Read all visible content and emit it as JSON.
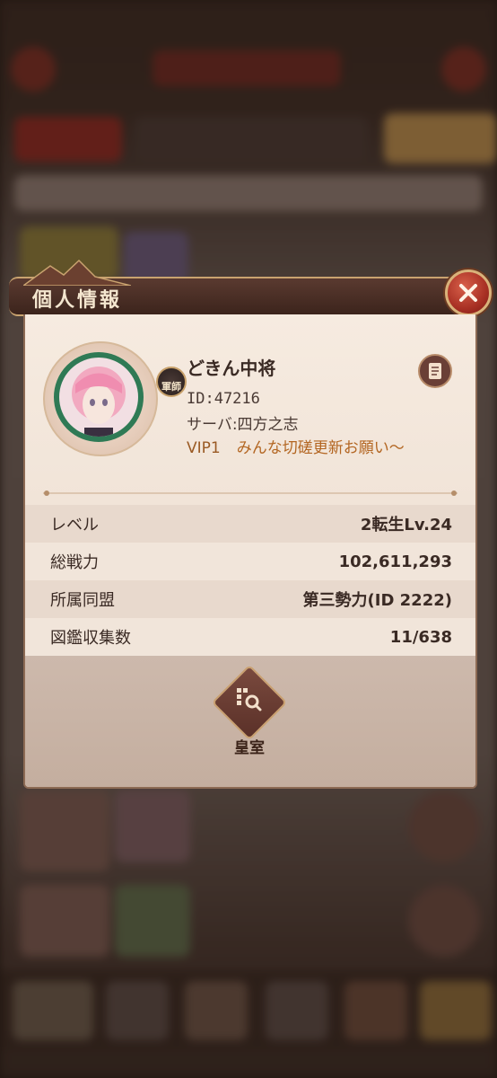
{
  "popup": {
    "title": "個人情報",
    "close_icon": "close-icon"
  },
  "profile": {
    "name": "どきん中将",
    "id_text": "ID:47216",
    "server_text": "サーバ:四方之志",
    "vip_level": "VIP1",
    "message": "みんな切磋更新お願い〜",
    "badge": "軍師",
    "note_icon": "document-icon"
  },
  "stats": [
    {
      "label": "レベル",
      "value": "2転生Lv.24"
    },
    {
      "label": "総戦力",
      "value": "102,611,293"
    },
    {
      "label": "所属同盟",
      "value": "第三勢力(ID 2222)"
    },
    {
      "label": "図鑑収集数",
      "value": "11/638"
    }
  ],
  "footer": {
    "royal_label": "皇室",
    "royal_icon": "search-grid-icon"
  },
  "colors": {
    "accent_gold": "#c9a36f",
    "close_red": "#a83024",
    "vip_text": "#b36622",
    "header_dark": "#3c241c"
  }
}
